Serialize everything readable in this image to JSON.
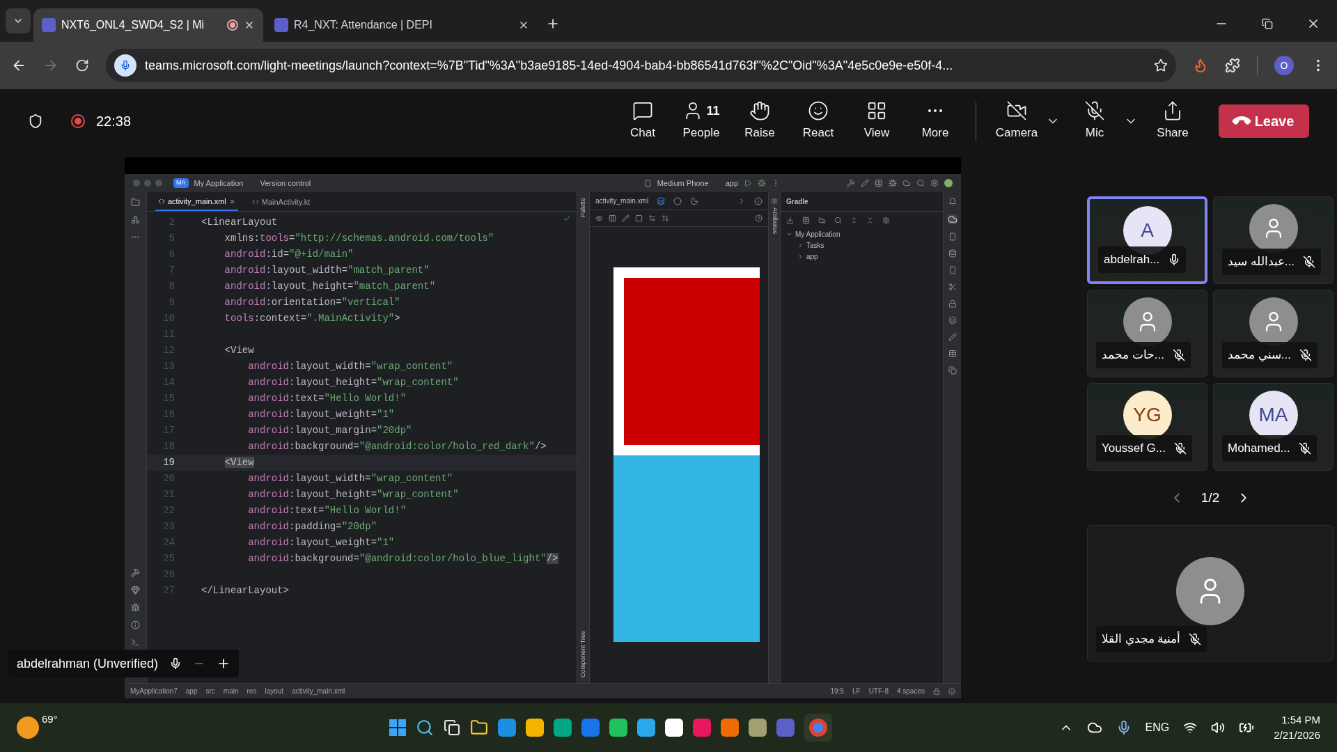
{
  "browser": {
    "tabs": [
      {
        "title": "NXT6_ONL4_SWD4_S2 | Mi",
        "selected": true,
        "recording": true
      },
      {
        "title": "R4_NXT: Attendance | DEPI",
        "selected": false,
        "recording": false
      }
    ],
    "url": "teams.microsoft.com/light-meetings/launch?context=%7B\"Tid\"%3A\"b3ae9185-14ed-4904-bab4-bb86541d763f\"%2C\"Oid\"%3A\"4e5c0e9e-e50f-4...",
    "profile_initial": "O"
  },
  "meeting_bar": {
    "recording": true,
    "elapsed": "22:38",
    "actions": [
      {
        "kind": "chat",
        "label": "Chat"
      },
      {
        "kind": "people",
        "label": "People",
        "count": "11"
      },
      {
        "kind": "raise",
        "label": "Raise"
      },
      {
        "kind": "react",
        "label": "React"
      },
      {
        "kind": "view",
        "label": "View"
      },
      {
        "kind": "more",
        "label": "More"
      }
    ],
    "devices": [
      {
        "kind": "camera",
        "label": "Camera",
        "on": false
      },
      {
        "kind": "mic",
        "label": "Mic",
        "on": false
      }
    ],
    "share": "Share",
    "leave": "Leave"
  },
  "shared_screen": {
    "ide": {
      "project_badge": "MA",
      "project": "My Application",
      "vcs": "Version control",
      "device": "Medium Phone",
      "run_config": "app",
      "editor_tabs": [
        {
          "title": "activity_main.xml",
          "selected": true
        },
        {
          "title": "MainActivity.kt",
          "selected": false
        }
      ],
      "code_lines": [
        {
          "number": "2",
          "current": false,
          "tokens": [
            {
              "text": "<LinearLayout",
              "kind": "plain"
            }
          ]
        },
        {
          "number": "5",
          "current": false,
          "tokens": [
            {
              "text": "    xmlns:",
              "kind": "plain"
            },
            {
              "text": "tools",
              "kind": "ns"
            },
            {
              "text": "=",
              "kind": "plain"
            },
            {
              "text": "\"http://schemas.android.com/tools\"",
              "kind": "str"
            }
          ]
        },
        {
          "number": "6",
          "current": false,
          "tokens": [
            {
              "text": "    android",
              "kind": "ns"
            },
            {
              "text": ":id=",
              "kind": "plain"
            },
            {
              "text": "\"@+id/main\"",
              "kind": "str"
            }
          ]
        },
        {
          "number": "7",
          "current": false,
          "tokens": [
            {
              "text": "    android",
              "kind": "ns"
            },
            {
              "text": ":layout_width=",
              "kind": "plain"
            },
            {
              "text": "\"match_parent\"",
              "kind": "str"
            }
          ]
        },
        {
          "number": "8",
          "current": false,
          "tokens": [
            {
              "text": "    android",
              "kind": "ns"
            },
            {
              "text": ":layout_height=",
              "kind": "plain"
            },
            {
              "text": "\"match_parent\"",
              "kind": "str"
            }
          ]
        },
        {
          "number": "9",
          "current": false,
          "tokens": [
            {
              "text": "    android",
              "kind": "ns"
            },
            {
              "text": ":orientation=",
              "kind": "plain"
            },
            {
              "text": "\"vertical\"",
              "kind": "str"
            }
          ]
        },
        {
          "number": "10",
          "current": false,
          "tokens": [
            {
              "text": "    tools",
              "kind": "ns"
            },
            {
              "text": ":context=",
              "kind": "plain"
            },
            {
              "text": "\".MainActivity\"",
              "kind": "str"
            },
            {
              "text": ">",
              "kind": "plain"
            }
          ]
        },
        {
          "number": "11",
          "current": false
        },
        {
          "number": "12",
          "current": false,
          "tokens": [
            {
              "text": "    <View",
              "kind": "plain"
            }
          ]
        },
        {
          "number": "13",
          "current": false,
          "tokens": [
            {
              "text": "        android",
              "kind": "ns"
            },
            {
              "text": ":layout_width=",
              "kind": "plain"
            },
            {
              "text": "\"wrap_content\"",
              "kind": "str"
            }
          ]
        },
        {
          "number": "14",
          "current": false,
          "tokens": [
            {
              "text": "        android",
              "kind": "ns"
            },
            {
              "text": ":layout_height=",
              "kind": "plain"
            },
            {
              "text": "\"wrap_content\"",
              "kind": "str"
            }
          ]
        },
        {
          "number": "15",
          "current": false,
          "tokens": [
            {
              "text": "        android",
              "kind": "ns"
            },
            {
              "text": ":text=",
              "kind": "plain"
            },
            {
              "text": "\"Hello World!\"",
              "kind": "str"
            }
          ]
        },
        {
          "number": "16",
          "current": false,
          "tokens": [
            {
              "text": "        android",
              "kind": "ns"
            },
            {
              "text": ":layout_weight=",
              "kind": "plain"
            },
            {
              "text": "\"1\"",
              "kind": "str"
            }
          ]
        },
        {
          "number": "17",
          "current": false,
          "tokens": [
            {
              "text": "        android",
              "kind": "ns"
            },
            {
              "text": ":layout_margin=",
              "kind": "plain"
            },
            {
              "text": "\"20dp\"",
              "kind": "str"
            }
          ]
        },
        {
          "number": "18",
          "current": false,
          "tokens": [
            {
              "text": "        android",
              "kind": "ns"
            },
            {
              "text": ":background=",
              "kind": "plain"
            },
            {
              "text": "\"@android:color/holo_red_dark\"",
              "kind": "str"
            },
            {
              "text": "/>",
              "kind": "plain"
            }
          ]
        },
        {
          "number": "19",
          "current": true,
          "tokens": [
            {
              "text": "    <View",
              "kind": "match"
            }
          ]
        },
        {
          "number": "20",
          "current": false,
          "tokens": [
            {
              "text": "        android",
              "kind": "ns"
            },
            {
              "text": ":layout_width=",
              "kind": "plain"
            },
            {
              "text": "\"wrap_content\"",
              "kind": "str"
            }
          ]
        },
        {
          "number": "21",
          "current": false,
          "tokens": [
            {
              "text": "        android",
              "kind": "ns"
            },
            {
              "text": ":layout_height=",
              "kind": "plain"
            },
            {
              "text": "\"wrap_content\"",
              "kind": "str"
            }
          ]
        },
        {
          "number": "22",
          "current": false,
          "tokens": [
            {
              "text": "        android",
              "kind": "ns"
            },
            {
              "text": ":text=",
              "kind": "plain"
            },
            {
              "text": "\"Hello World!\"",
              "kind": "str"
            }
          ]
        },
        {
          "number": "23",
          "current": false,
          "tokens": [
            {
              "text": "        android",
              "kind": "ns"
            },
            {
              "text": ":padding=",
              "kind": "plain"
            },
            {
              "text": "\"20dp\"",
              "kind": "str"
            }
          ]
        },
        {
          "number": "24",
          "current": false,
          "tokens": [
            {
              "text": "        android",
              "kind": "ns"
            },
            {
              "text": ":layout_weight=",
              "kind": "plain"
            },
            {
              "text": "\"1\"",
              "kind": "str"
            }
          ]
        },
        {
          "number": "25",
          "current": false,
          "tokens": [
            {
              "text": "        android",
              "kind": "ns"
            },
            {
              "text": ":background=",
              "kind": "plain"
            },
            {
              "text": "\"@android:color/holo_blue_light\"",
              "kind": "str"
            },
            {
              "text": "/>",
              "kind": "match"
            }
          ]
        },
        {
          "number": "26",
          "current": false
        },
        {
          "number": "27",
          "current": false,
          "tokens": [
            {
              "text": "</LinearLayout>",
              "kind": "plain"
            }
          ]
        }
      ],
      "preview": {
        "file": "activity_main.xml",
        "palette": "Palette",
        "attributes": "Attributes",
        "component_tree": "Component Tree"
      },
      "gradle": {
        "title": "Gradle",
        "tree": [
          {
            "label": "My Application",
            "expanded": true,
            "children": [
              {
                "label": "Tasks",
                "expanded": false
              },
              {
                "label": "app",
                "expanded": false
              }
            ]
          }
        ]
      },
      "breadcrumbs": [
        "MyApplication7",
        "app",
        "src",
        "main",
        "res",
        "layout",
        "activity_main.xml"
      ],
      "status": [
        "19:5",
        "LF",
        "UTF-8",
        "4 spaces"
      ]
    },
    "presenter": {
      "name": "abdelrahman (Unverified)"
    }
  },
  "participants": {
    "tiles": [
      {
        "name": "abdelrah...",
        "initials": "A",
        "color": "#e6e4f5",
        "muted": false,
        "speaking": true
      },
      {
        "name": "عبدالله سيد...",
        "color": "#8e8e8e",
        "muted": true,
        "speaking": false
      },
      {
        "name": "حات محمد...",
        "color": "#8e8e8e",
        "muted": true,
        "speaking": false
      },
      {
        "name": "سني محمد...",
        "color": "#8e8e8e",
        "muted": true,
        "speaking": false
      },
      {
        "name": "Youssef G...",
        "initials": "YG",
        "color": "#fbeccb",
        "muted": true,
        "speaking": false
      },
      {
        "name": "Mohamed...",
        "initials": "MA",
        "color": "#e6e4f5",
        "muted": true,
        "speaking": false
      }
    ],
    "page": "1/2",
    "pinned": {
      "name": "أمنية مجدي القلا",
      "color": "#8e8e8e",
      "muted": true
    }
  },
  "taskbar": {
    "weather": "69°",
    "language": "ENG",
    "time": "1:54 PM",
    "date": "2/21/2026"
  }
}
